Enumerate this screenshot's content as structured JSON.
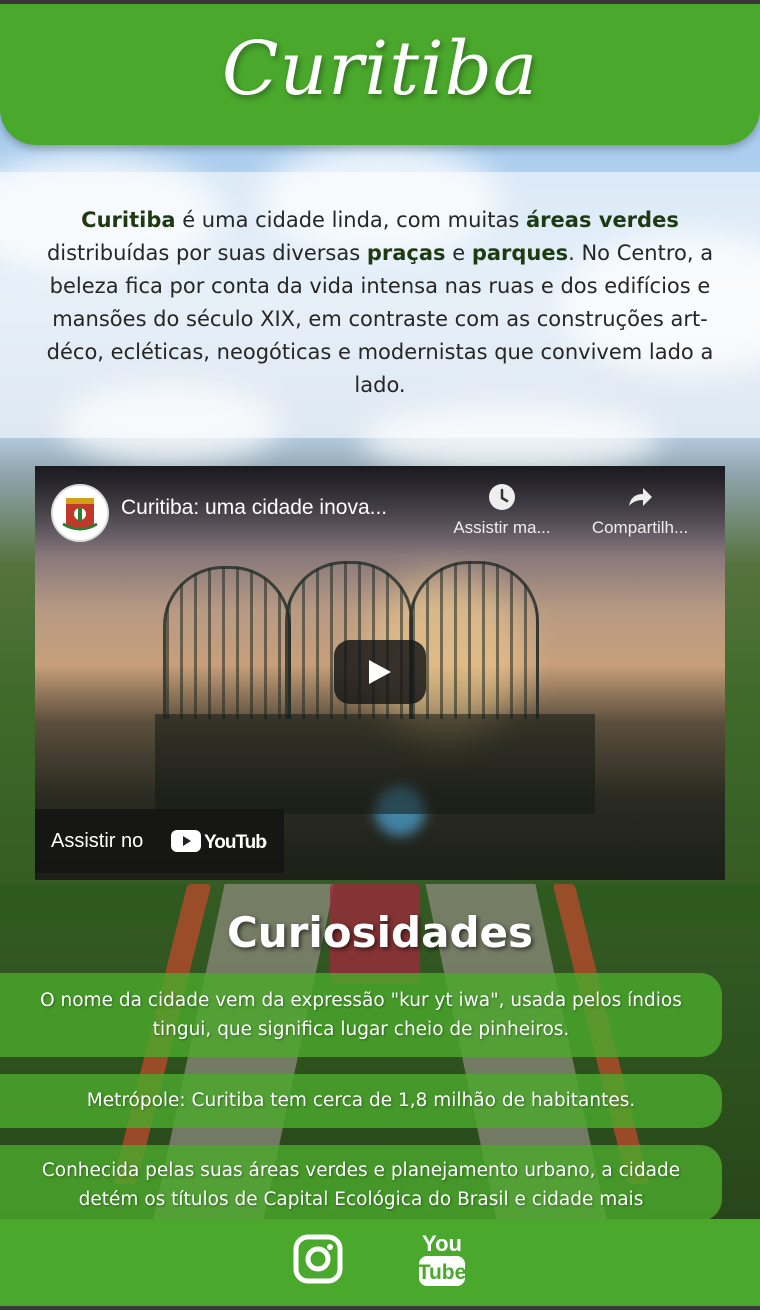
{
  "header": {
    "title": "Curitiba"
  },
  "intro": {
    "parts": [
      {
        "text": "Curitiba",
        "bold": true
      },
      {
        "text": " é uma cidade linda, com muitas ",
        "bold": false
      },
      {
        "text": "áreas verdes",
        "bold": true
      },
      {
        "text": " distribuídas por suas diversas ",
        "bold": false
      },
      {
        "text": "praças",
        "bold": true
      },
      {
        "text": " e ",
        "bold": false
      },
      {
        "text": "parques",
        "bold": true
      },
      {
        "text": ". No Centro, a beleza fica por conta da vida intensa nas ruas e dos edifícios e mansões do século XIX, em contraste com as construções art-déco, ecléticas, neogóticas e modernistas que convivem lado a lado.",
        "bold": false
      }
    ]
  },
  "video": {
    "title": "Curitiba: uma cidade inova...",
    "watch_later_label": "Assistir ma...",
    "share_label": "Compartilh...",
    "watch_on_label": "Assistir no",
    "youtube_wordmark": "YouTube",
    "icons": {
      "watch_later": "clock-icon",
      "share": "share-arrow-icon",
      "play": "play-icon",
      "channel": "channel-crest-icon"
    }
  },
  "curiosities": {
    "title": "Curiosidades",
    "items": [
      "O nome da cidade vem da expressão \"kur yt iwa\", usada pelos índios tingui, que significa lugar cheio de pinheiros.",
      "Metrópole: Curitiba tem cerca de 1,8 milhão de habitantes.",
      "Conhecida pelas suas áreas verdes e planejamento urbano, a cidade detém os títulos de Capital Ecológica do Brasil e cidade mais"
    ]
  },
  "footer": {
    "instagram_icon": "instagram-icon",
    "youtube_icon": "youtube-icon",
    "youtube_top": "You",
    "youtube_bottom": "Tube"
  },
  "colors": {
    "primary_green": "#4aa82c",
    "dark_text": "#262626",
    "white": "#ffffff"
  }
}
